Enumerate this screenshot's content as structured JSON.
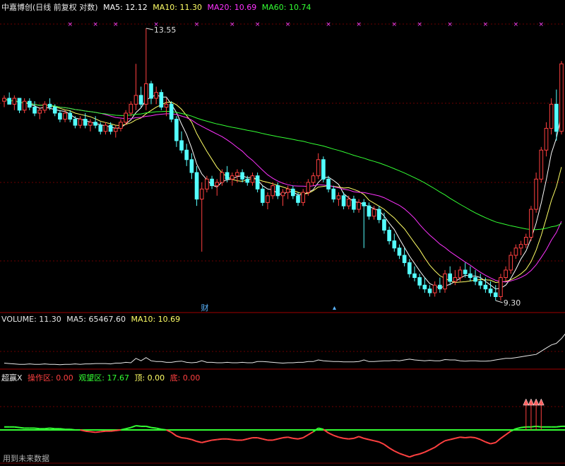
{
  "main_header": {
    "stock_name": "中嘉博创",
    "mode": "(日线 前复权 对数)",
    "ma5": "MA5: 12.12",
    "ma10": "MA10: 11.30",
    "ma20": "MA20: 10.69",
    "ma60": "MA60: 10.74"
  },
  "volume_header": {
    "volume": "VOLUME: 11.30",
    "ma5": "MA5: 65467.60",
    "ma10": "MA10: 10.69"
  },
  "indicator_header": {
    "name": "超赢X",
    "operate": "操作区: 0.00",
    "watch": "观望区: 17.67",
    "top": "顶: 0.00",
    "bottom": "底: 0.00"
  },
  "footer_text": "用到未来数据",
  "annotations": {
    "high_label": "13.55",
    "low_label": "9.30",
    "finance_marker": "财"
  },
  "colors": {
    "up": "#ff4040",
    "down": "#54ffff",
    "ma5": "#ffff66",
    "ma10": "#ffffff",
    "ma20": "#ff33ff",
    "ma60": "#33ff33",
    "grid": "#6b0000",
    "panel_border": "#a00000",
    "signal": "#ff44ff"
  },
  "chart_data": {
    "type": "candlestick",
    "price_scale": "log",
    "price_range": [
      9.3,
      13.55
    ],
    "candles": [
      [
        12.25,
        12.35,
        12.15,
        12.3
      ],
      [
        12.3,
        12.4,
        12.2,
        12.2
      ],
      [
        12.2,
        12.35,
        12.1,
        12.3
      ],
      [
        12.3,
        12.3,
        12.05,
        12.1
      ],
      [
        12.1,
        12.3,
        12.05,
        12.25
      ],
      [
        12.25,
        12.3,
        12.1,
        12.15
      ],
      [
        12.15,
        12.25,
        12.0,
        12.05
      ],
      [
        12.05,
        12.15,
        11.95,
        12.1
      ],
      [
        12.1,
        12.25,
        12.05,
        12.2
      ],
      [
        12.2,
        12.3,
        12.1,
        12.15
      ],
      [
        12.15,
        12.2,
        12.0,
        12.05
      ],
      [
        12.05,
        12.1,
        11.9,
        11.95
      ],
      [
        11.95,
        12.1,
        11.9,
        12.05
      ],
      [
        12.05,
        12.1,
        11.9,
        11.95
      ],
      [
        11.95,
        12.0,
        11.8,
        11.85
      ],
      [
        11.85,
        12.0,
        11.8,
        11.95
      ],
      [
        11.95,
        12.05,
        11.8,
        11.85
      ],
      [
        11.85,
        11.95,
        11.75,
        11.9
      ],
      [
        11.9,
        12.0,
        11.8,
        11.85
      ],
      [
        11.85,
        11.9,
        11.7,
        11.75
      ],
      [
        11.75,
        11.9,
        11.7,
        11.85
      ],
      [
        11.85,
        11.9,
        11.7,
        11.75
      ],
      [
        11.75,
        11.85,
        11.65,
        11.8
      ],
      [
        11.8,
        11.95,
        11.75,
        11.9
      ],
      [
        11.9,
        12.1,
        11.85,
        12.05
      ],
      [
        12.05,
        12.25,
        12.0,
        12.2
      ],
      [
        12.2,
        12.9,
        12.1,
        12.35
      ],
      [
        12.35,
        12.5,
        12.15,
        12.2
      ],
      [
        12.2,
        13.55,
        12.1,
        12.55
      ],
      [
        12.55,
        12.6,
        12.2,
        12.3
      ],
      [
        12.3,
        12.5,
        12.2,
        12.4
      ],
      [
        12.4,
        12.45,
        12.1,
        12.15
      ],
      [
        12.15,
        12.3,
        12.0,
        12.2
      ],
      [
        12.2,
        12.25,
        11.9,
        11.95
      ],
      [
        11.95,
        12.0,
        11.5,
        11.6
      ],
      [
        11.6,
        11.75,
        11.4,
        11.45
      ],
      [
        11.45,
        11.55,
        11.2,
        11.3
      ],
      [
        11.3,
        11.4,
        11.0,
        11.1
      ],
      [
        11.1,
        11.2,
        10.6,
        10.7
      ],
      [
        10.7,
        10.95,
        9.95,
        10.85
      ],
      [
        10.85,
        11.05,
        10.8,
        11.0
      ],
      [
        11.0,
        11.05,
        10.85,
        10.9
      ],
      [
        10.9,
        11.0,
        10.75,
        10.95
      ],
      [
        10.95,
        11.15,
        10.9,
        11.1
      ],
      [
        11.1,
        11.2,
        10.95,
        11.0
      ],
      [
        11.0,
        11.1,
        10.9,
        11.05
      ],
      [
        11.05,
        11.15,
        10.95,
        11.1
      ],
      [
        11.1,
        11.15,
        10.95,
        11.0
      ],
      [
        11.0,
        11.05,
        10.9,
        10.95
      ],
      [
        10.95,
        11.1,
        10.9,
        11.05
      ],
      [
        11.05,
        11.1,
        10.8,
        10.85
      ],
      [
        10.85,
        10.9,
        10.6,
        10.65
      ],
      [
        10.65,
        10.8,
        10.55,
        10.75
      ],
      [
        10.75,
        10.95,
        10.7,
        10.9
      ],
      [
        10.9,
        10.95,
        10.7,
        10.75
      ],
      [
        10.75,
        10.85,
        10.6,
        10.8
      ],
      [
        10.8,
        10.9,
        10.7,
        10.85
      ],
      [
        10.85,
        10.9,
        10.7,
        10.75
      ],
      [
        10.75,
        10.8,
        10.6,
        10.65
      ],
      [
        10.65,
        10.85,
        10.6,
        10.8
      ],
      [
        10.8,
        11.0,
        10.75,
        10.95
      ],
      [
        10.95,
        11.1,
        10.9,
        11.05
      ],
      [
        11.05,
        11.4,
        11.0,
        11.3
      ],
      [
        11.3,
        11.35,
        10.95,
        11.0
      ],
      [
        11.0,
        11.05,
        10.8,
        10.85
      ],
      [
        10.85,
        10.9,
        10.65,
        10.7
      ],
      [
        10.7,
        10.8,
        10.6,
        10.75
      ],
      [
        10.75,
        10.8,
        10.55,
        10.6
      ],
      [
        10.6,
        10.75,
        10.55,
        10.7
      ],
      [
        10.7,
        10.75,
        10.5,
        10.55
      ],
      [
        10.55,
        10.7,
        10.5,
        10.65
      ],
      [
        10.65,
        10.7,
        10.0,
        10.6
      ],
      [
        10.6,
        10.65,
        10.4,
        10.45
      ],
      [
        10.45,
        10.6,
        10.4,
        10.55
      ],
      [
        10.55,
        10.6,
        10.35,
        10.4
      ],
      [
        10.4,
        10.5,
        10.2,
        10.25
      ],
      [
        10.25,
        10.3,
        10.05,
        10.1
      ],
      [
        10.1,
        10.2,
        9.95,
        10.0
      ],
      [
        10.0,
        10.05,
        9.85,
        9.9
      ],
      [
        9.9,
        10.0,
        9.75,
        9.8
      ],
      [
        9.8,
        9.85,
        9.6,
        9.65
      ],
      [
        9.65,
        9.75,
        9.55,
        9.6
      ],
      [
        9.6,
        9.65,
        9.45,
        9.5
      ],
      [
        9.5,
        9.6,
        9.4,
        9.45
      ],
      [
        9.45,
        9.5,
        9.35,
        9.4
      ],
      [
        9.4,
        9.55,
        9.35,
        9.5
      ],
      [
        9.5,
        9.6,
        9.4,
        9.45
      ],
      [
        9.45,
        9.7,
        9.4,
        9.65
      ],
      [
        9.65,
        9.75,
        9.5,
        9.55
      ],
      [
        9.55,
        9.7,
        9.5,
        9.6
      ],
      [
        9.6,
        9.75,
        9.55,
        9.7
      ],
      [
        9.7,
        9.8,
        9.6,
        9.65
      ],
      [
        9.65,
        9.75,
        9.55,
        9.6
      ],
      [
        9.6,
        9.7,
        9.5,
        9.55
      ],
      [
        9.55,
        9.65,
        9.45,
        9.5
      ],
      [
        9.5,
        9.6,
        9.4,
        9.45
      ],
      [
        9.45,
        9.55,
        9.35,
        9.4
      ],
      [
        9.4,
        9.5,
        9.3,
        9.35
      ],
      [
        9.35,
        9.65,
        9.3,
        9.6
      ],
      [
        9.6,
        9.75,
        9.55,
        9.7
      ],
      [
        9.7,
        9.95,
        9.65,
        9.9
      ],
      [
        9.9,
        10.05,
        9.85,
        10.0
      ],
      [
        10.0,
        10.1,
        9.9,
        10.05
      ],
      [
        10.05,
        10.2,
        10.0,
        10.15
      ],
      [
        10.15,
        10.6,
        10.1,
        10.55
      ],
      [
        10.55,
        11.1,
        10.5,
        11.0
      ],
      [
        11.0,
        11.5,
        10.95,
        11.45
      ],
      [
        11.45,
        11.9,
        11.35,
        11.8
      ],
      [
        11.8,
        12.3,
        11.7,
        12.2
      ],
      [
        12.2,
        12.45,
        11.6,
        11.75
      ],
      [
        11.75,
        12.95,
        11.7,
        12.9
      ]
    ],
    "volume_line": [
      0.08,
      0.07,
      0.06,
      0.05,
      0.05,
      0.06,
      0.05,
      0.05,
      0.06,
      0.05,
      0.05,
      0.04,
      0.05,
      0.05,
      0.06,
      0.05,
      0.06,
      0.06,
      0.07,
      0.07,
      0.07,
      0.06,
      0.08,
      0.08,
      0.1,
      0.09,
      0.2,
      0.14,
      0.22,
      0.14,
      0.12,
      0.12,
      0.1,
      0.1,
      0.12,
      0.13,
      0.1,
      0.09,
      0.1,
      0.14,
      0.1,
      0.1,
      0.09,
      0.09,
      0.1,
      0.09,
      0.09,
      0.1,
      0.09,
      0.09,
      0.12,
      0.12,
      0.11,
      0.1,
      0.09,
      0.08,
      0.09,
      0.09,
      0.1,
      0.1,
      0.12,
      0.12,
      0.16,
      0.14,
      0.13,
      0.12,
      0.12,
      0.11,
      0.11,
      0.11,
      0.12,
      0.16,
      0.12,
      0.12,
      0.13,
      0.14,
      0.14,
      0.15,
      0.14,
      0.16,
      0.18,
      0.16,
      0.15,
      0.14,
      0.15,
      0.14,
      0.14,
      0.17,
      0.16,
      0.16,
      0.14,
      0.13,
      0.14,
      0.14,
      0.13,
      0.13,
      0.14,
      0.16,
      0.18,
      0.2,
      0.2,
      0.22,
      0.24,
      0.26,
      0.28,
      0.3,
      0.38,
      0.46,
      0.54,
      0.58,
      0.7,
      0.86,
      0.93,
      0.97,
      0.99,
      1.0,
      0.97
    ],
    "indicator_line": [
      0.05,
      0.05,
      0.05,
      0.04,
      0.03,
      0.03,
      0.03,
      0.02,
      0.02,
      0.03,
      0.02,
      0.02,
      0.01,
      0.01,
      0.0,
      0.0,
      -0.02,
      -0.03,
      -0.04,
      -0.03,
      -0.02,
      -0.02,
      -0.01,
      0.0,
      0.02,
      0.04,
      0.07,
      0.06,
      0.06,
      0.04,
      0.03,
      0.01,
      0.0,
      -0.04,
      -0.1,
      -0.13,
      -0.14,
      -0.16,
      -0.19,
      -0.21,
      -0.19,
      -0.17,
      -0.16,
      -0.15,
      -0.15,
      -0.16,
      -0.17,
      -0.17,
      -0.15,
      -0.13,
      -0.13,
      -0.15,
      -0.17,
      -0.17,
      -0.15,
      -0.13,
      -0.12,
      -0.14,
      -0.15,
      -0.13,
      -0.08,
      -0.03,
      0.03,
      0.01,
      -0.05,
      -0.09,
      -0.12,
      -0.14,
      -0.15,
      -0.14,
      -0.11,
      -0.14,
      -0.16,
      -0.18,
      -0.2,
      -0.24,
      -0.3,
      -0.35,
      -0.39,
      -0.42,
      -0.45,
      -0.42,
      -0.4,
      -0.37,
      -0.33,
      -0.29,
      -0.23,
      -0.18,
      -0.16,
      -0.14,
      -0.12,
      -0.13,
      -0.12,
      -0.13,
      -0.16,
      -0.2,
      -0.23,
      -0.21,
      -0.14,
      -0.08,
      -0.02,
      0.02,
      0.04,
      0.05,
      0.05,
      0.06,
      0.05,
      0.05,
      0.05,
      0.05,
      0.06,
      0.06,
      0.2,
      0.38,
      0.48,
      0.53,
      0.58
    ],
    "signals_top": [
      13,
      18,
      22,
      30,
      38,
      45,
      50,
      56,
      64,
      70,
      77,
      82,
      88,
      95,
      101,
      106,
      112,
      117,
      124,
      130,
      136
    ],
    "signals_arrows": [
      103,
      104,
      105,
      106
    ]
  }
}
